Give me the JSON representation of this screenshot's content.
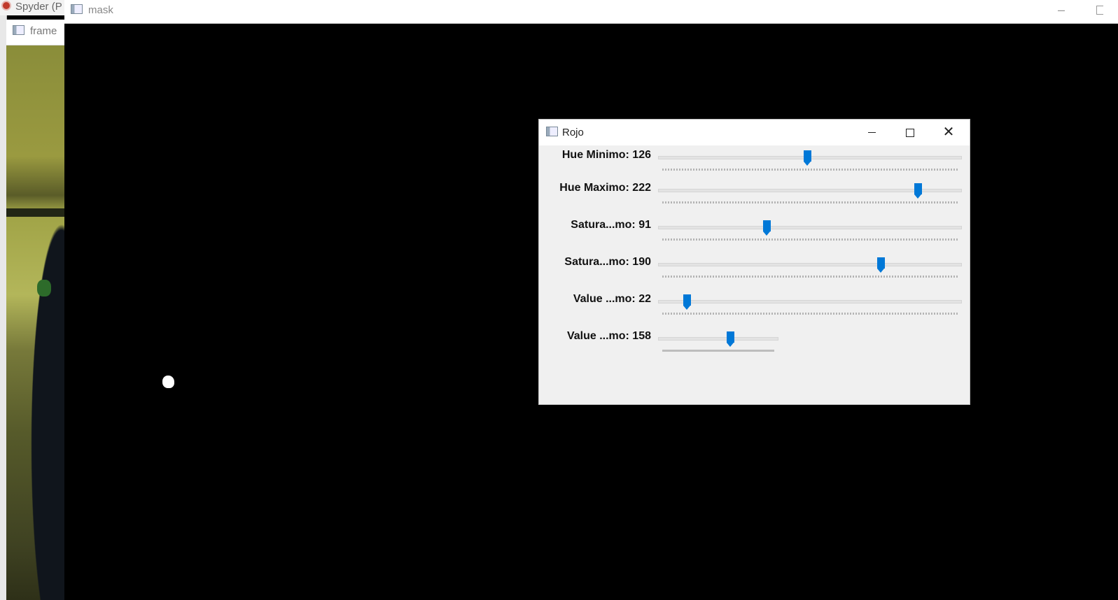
{
  "spyder": {
    "title": "Spyder (P"
  },
  "frame_window": {
    "title": "frame"
  },
  "mask_window": {
    "title": "mask"
  },
  "rojo_window": {
    "title": "Rojo",
    "controls": {
      "minimize_icon": "minimize-icon",
      "maximize_icon": "maximize-icon",
      "close_icon": "close-icon"
    },
    "trackbars": [
      {
        "label": "Hue Minimo: 126",
        "value": 126,
        "max": 255
      },
      {
        "label": "Hue Maximo: 222",
        "value": 222,
        "max": 255
      },
      {
        "label": "Satura...mo: 91",
        "value": 91,
        "max": 255
      },
      {
        "label": "Satura...mo: 190",
        "value": 190,
        "max": 255
      },
      {
        "label": "Value ...mo: 22",
        "value": 22,
        "max": 255
      },
      {
        "label": "Value ...mo: 158",
        "value": 158,
        "max": 255
      }
    ]
  },
  "colors": {
    "accent": "#0078d7",
    "mask_background": "#000000",
    "panel_background": "#f0f0f0"
  }
}
